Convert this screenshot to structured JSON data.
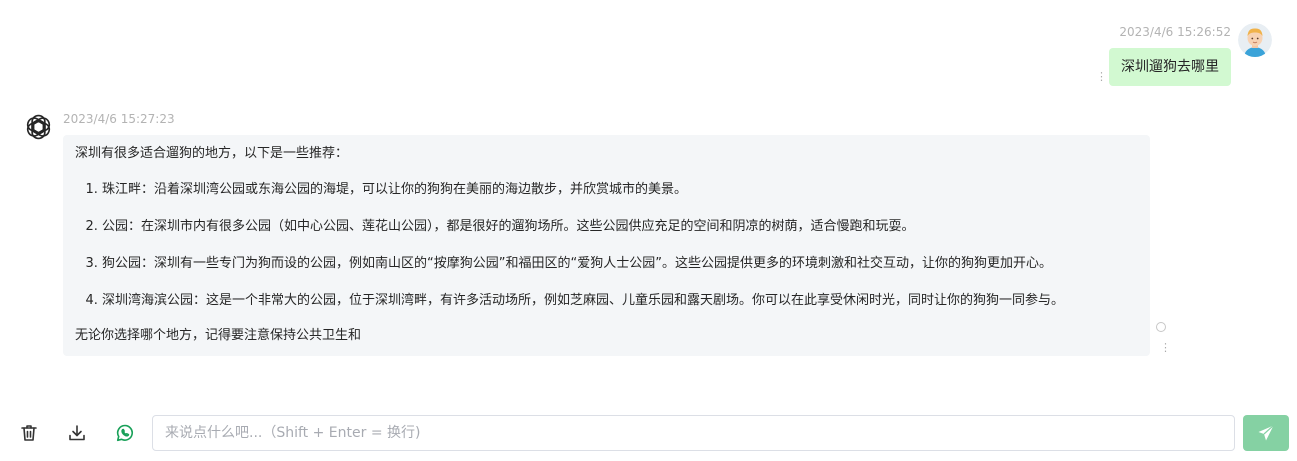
{
  "user_message": {
    "timestamp": "2023/4/6 15:26:52",
    "text": "深圳遛狗去哪里"
  },
  "ai_message": {
    "timestamp": "2023/4/6 15:27:23",
    "intro": "深圳有很多适合遛狗的地方，以下是一些推荐：",
    "items": [
      "珠江畔：沿着深圳湾公园或东海公园的海堤，可以让你的狗狗在美丽的海边散步，并欣赏城市的美景。",
      "公园：在深圳市内有很多公园（如中心公园、莲花山公园），都是很好的遛狗场所。这些公园供应充足的空间和阴凉的树荫，适合慢跑和玩耍。",
      "狗公园：深圳有一些专门为狗而设的公园，例如南山区的“按摩狗公园”和福田区的“爱狗人士公园”。这些公园提供更多的环境刺激和社交互动，让你的狗狗更加开心。",
      "深圳湾海滨公园：这是一个非常大的公园，位于深圳湾畔，有许多活动场所，例如芝麻园、儿童乐园和露天剧场。你可以在此享受休闲时光，同时让你的狗狗一同参与。"
    ],
    "outro": "无论你选择哪个地方，记得要注意保持公共卫生和"
  },
  "input": {
    "placeholder": "来说点什么吧...（Shift + Enter = 换行)",
    "value": ""
  },
  "icons": {
    "delete": "trash-icon",
    "download": "download-icon",
    "whatsapp": "whatsapp-icon",
    "send": "send-icon",
    "more": "more-vertical-icon",
    "ai_avatar": "openai-logo-icon",
    "loading": "loading-ring-icon"
  },
  "colors": {
    "user_bubble": "#d2f9d1",
    "ai_bubble": "#f4f6f8",
    "send_button": "#85d1a3",
    "whatsapp": "#18a058"
  }
}
